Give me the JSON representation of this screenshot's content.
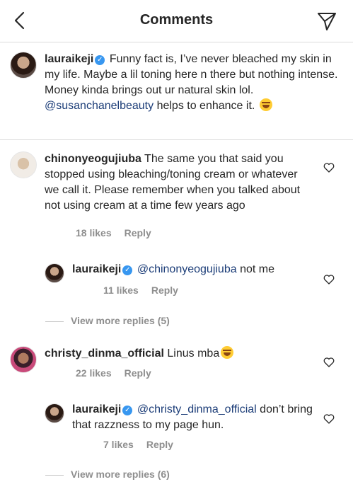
{
  "header": {
    "title": "Comments"
  },
  "caption": {
    "username": "lauraikeji",
    "text_before": " Funny fact is, I’ve never bleached my skin in my life. Maybe a lil toning here n there but nothing intense. Money kinda brings out ur natural skin lol. ",
    "mention": "@susanchanelbeauty",
    "text_after": " helps to enhance it. "
  },
  "comments": [
    {
      "username": "chinonyeogujiuba",
      "text": " The same you that said you stopped using bleaching/toning cream or whatever we call it. Please remember when you talked about not using cream at a time few years ago",
      "likes": "18 likes",
      "reply": "Reply",
      "reply_item": {
        "username": "lauraikeji",
        "mention": "@chinonyeogujiuba",
        "text": " not me",
        "likes": "11 likes",
        "reply": "Reply"
      },
      "view_more": "View more replies (5)"
    },
    {
      "username": "christy_dinma_official",
      "text": " Linus mba",
      "likes": "22 likes",
      "reply": "Reply",
      "reply_item": {
        "username": "lauraikeji",
        "mention": "@christy_dinma_official",
        "text": " don’t bring that razzness to my page hun.",
        "likes": "7 likes",
        "reply": "Reply"
      },
      "view_more": "View more replies (6)"
    }
  ],
  "icons": {
    "back": "chevron-left-icon",
    "send": "paper-plane-icon",
    "like": "heart-outline-icon",
    "verified": "verified-badge-icon",
    "emoji": "laughing-emoji-icon"
  },
  "colors": {
    "mention": "#1c3d78",
    "verified": "#3897f0",
    "meta": "#8e8e8e"
  }
}
